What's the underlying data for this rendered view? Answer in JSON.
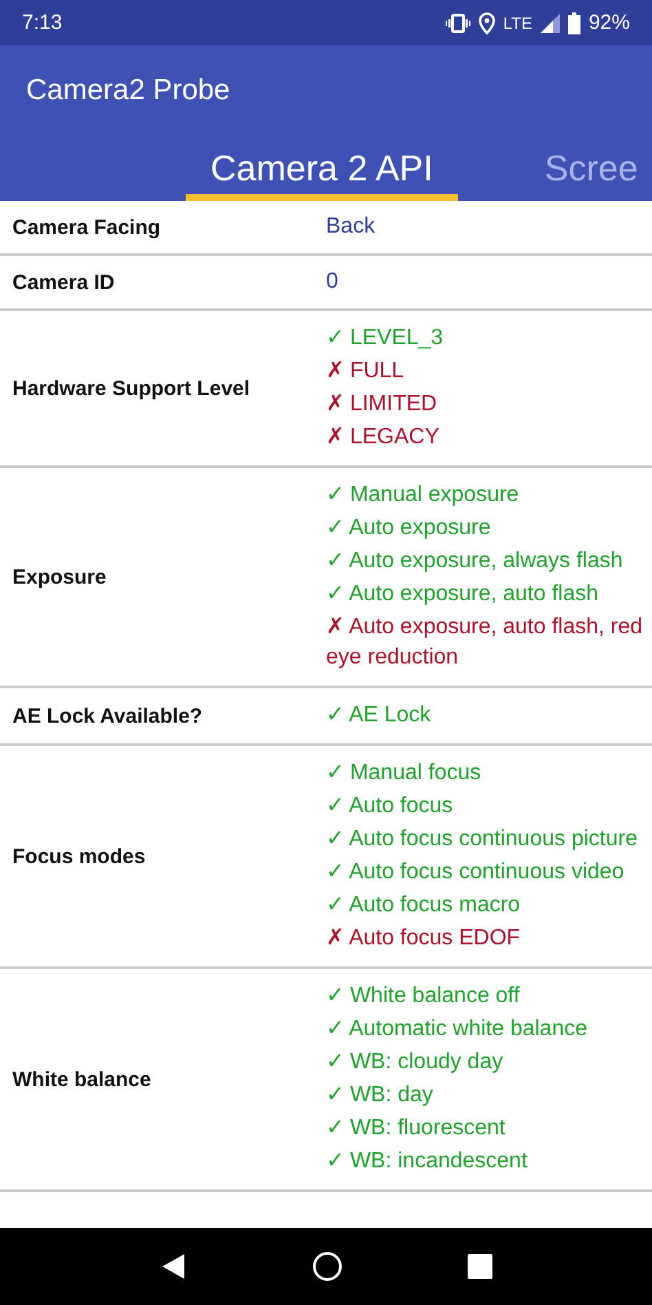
{
  "status_bar": {
    "time": "7:13",
    "network": "LTE",
    "battery": "92%"
  },
  "app_bar": {
    "title": "Camera2 Probe"
  },
  "tabs": [
    {
      "label": "Camera 2 API",
      "selected": true
    },
    {
      "label": "Scree",
      "selected": false
    }
  ],
  "rows": [
    {
      "label": "Camera Facing",
      "kind": "plain",
      "value": "Back"
    },
    {
      "label": "Camera ID",
      "kind": "plain",
      "value": "0"
    },
    {
      "label": "Hardware Support Level",
      "kind": "list",
      "items": [
        {
          "text": "✓ LEVEL_3",
          "supported": true
        },
        {
          "text": "✗ FULL",
          "supported": false
        },
        {
          "text": "✗ LIMITED",
          "supported": false
        },
        {
          "text": "✗ LEGACY",
          "supported": false
        }
      ]
    },
    {
      "label": "Exposure",
      "kind": "list",
      "items": [
        {
          "text": "✓ Manual exposure",
          "supported": true
        },
        {
          "text": "✓ Auto exposure",
          "supported": true
        },
        {
          "text": "✓ Auto exposure, always flash",
          "supported": true
        },
        {
          "text": "✓ Auto exposure, auto flash",
          "supported": true
        },
        {
          "text": "✗ Auto exposure, auto flash, red eye reduction",
          "supported": false
        }
      ]
    },
    {
      "label": "AE Lock Available?",
      "kind": "list",
      "items": [
        {
          "text": "✓ AE Lock",
          "supported": true
        }
      ]
    },
    {
      "label": "Focus modes",
      "kind": "list",
      "items": [
        {
          "text": "✓ Manual focus",
          "supported": true
        },
        {
          "text": "✓ Auto focus",
          "supported": true
        },
        {
          "text": "✓ Auto focus continuous picture",
          "supported": true
        },
        {
          "text": "✓ Auto focus continuous video",
          "supported": true
        },
        {
          "text": "✓ Auto focus macro",
          "supported": true
        },
        {
          "text": "✗ Auto focus EDOF",
          "supported": false
        }
      ]
    },
    {
      "label": "White balance",
      "kind": "list",
      "items": [
        {
          "text": "✓ White balance off",
          "supported": true
        },
        {
          "text": "✓ Automatic white balance",
          "supported": true
        },
        {
          "text": "✓ WB: cloudy day",
          "supported": true
        },
        {
          "text": "✓ WB: day",
          "supported": true
        },
        {
          "text": "✓ WB: fluorescent",
          "supported": true
        },
        {
          "text": "✓ WB: incandescent",
          "supported": true
        }
      ]
    }
  ]
}
